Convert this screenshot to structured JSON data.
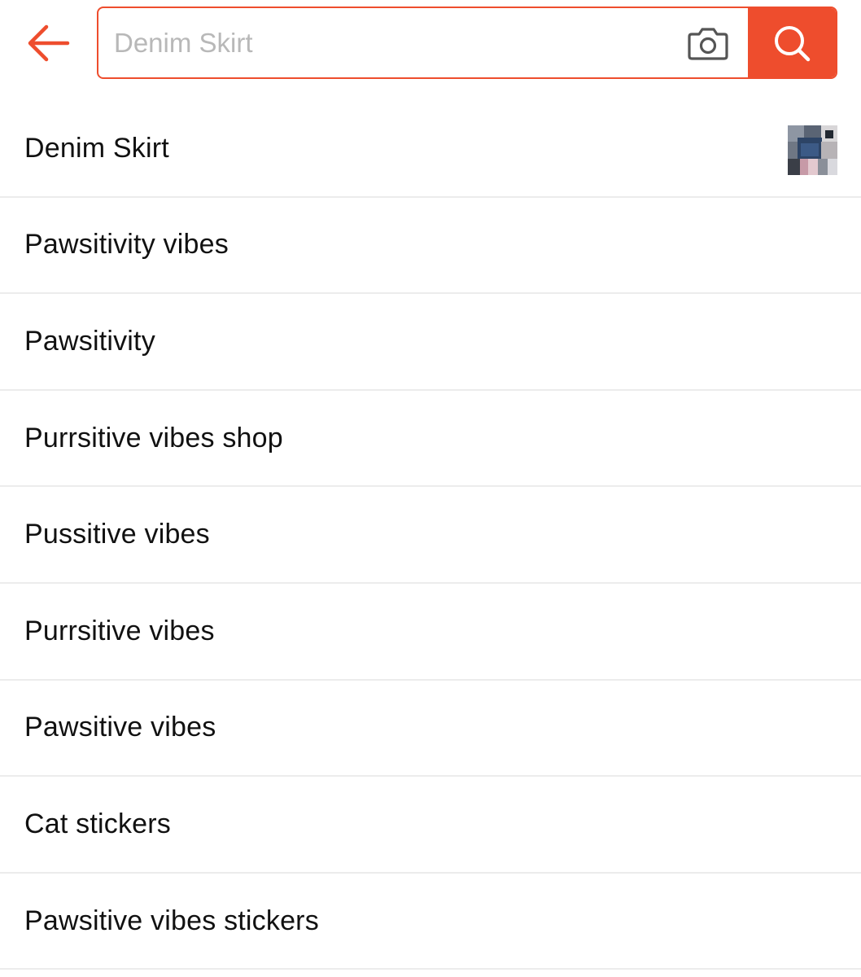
{
  "search": {
    "placeholder": "Denim Skirt",
    "value": ""
  },
  "colors": {
    "accent": "#ee4d2d",
    "divider": "#ececec",
    "placeholder": "#b8b8b8"
  },
  "icons": {
    "back": "arrow-left-icon",
    "camera": "camera-icon",
    "search": "magnifier-icon"
  },
  "suggestions": [
    {
      "label": "Denim Skirt",
      "has_thumbnail": true
    },
    {
      "label": "Pawsitivity vibes"
    },
    {
      "label": "Pawsitivity"
    },
    {
      "label": "Purrsitive vibes shop"
    },
    {
      "label": "Pussitive vibes"
    },
    {
      "label": "Purrsitive vibes"
    },
    {
      "label": "Pawsitive vibes"
    },
    {
      "label": "Cat stickers"
    },
    {
      "label": "Pawsitive vibes stickers"
    }
  ]
}
